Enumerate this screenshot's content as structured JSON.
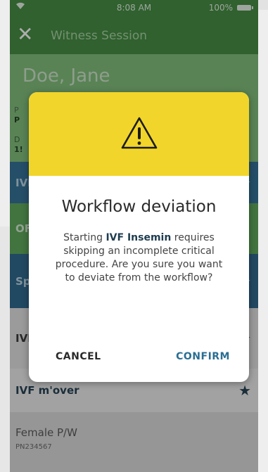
{
  "status_bar": {
    "wifi_icon": "wifi-icon",
    "time": "8:08 AM",
    "battery": "100%"
  },
  "nav": {
    "close_icon": "close-icon",
    "title": "Witness Session"
  },
  "patient": {
    "name": "Doe, Jane",
    "line1": "P",
    "line2": "P",
    "line3": "D",
    "line4": "1!"
  },
  "list": {
    "ivf": "IVI",
    "or": "OF",
    "sp": "Sp",
    "ivf2": "IVI",
    "mover": "IVF m'over",
    "female_label": "Female P/W",
    "female_id": "PN234567"
  },
  "dialog": {
    "icon": "warning-icon",
    "title": "Workflow deviation",
    "message_pre": "Starting ",
    "message_bold": "IVF Insemin",
    "message_post": " requires skipping an incomplete critical procedure. Are you sure you want to deviate from the workflow?",
    "cancel": "CANCEL",
    "confirm": "CONFIRM"
  },
  "colors": {
    "green_dark": "#3f8a3c",
    "green_light": "#7fbf79",
    "blue": "#2f6f95",
    "yellow": "#f2d52a",
    "confirm": "#2a6e93"
  }
}
